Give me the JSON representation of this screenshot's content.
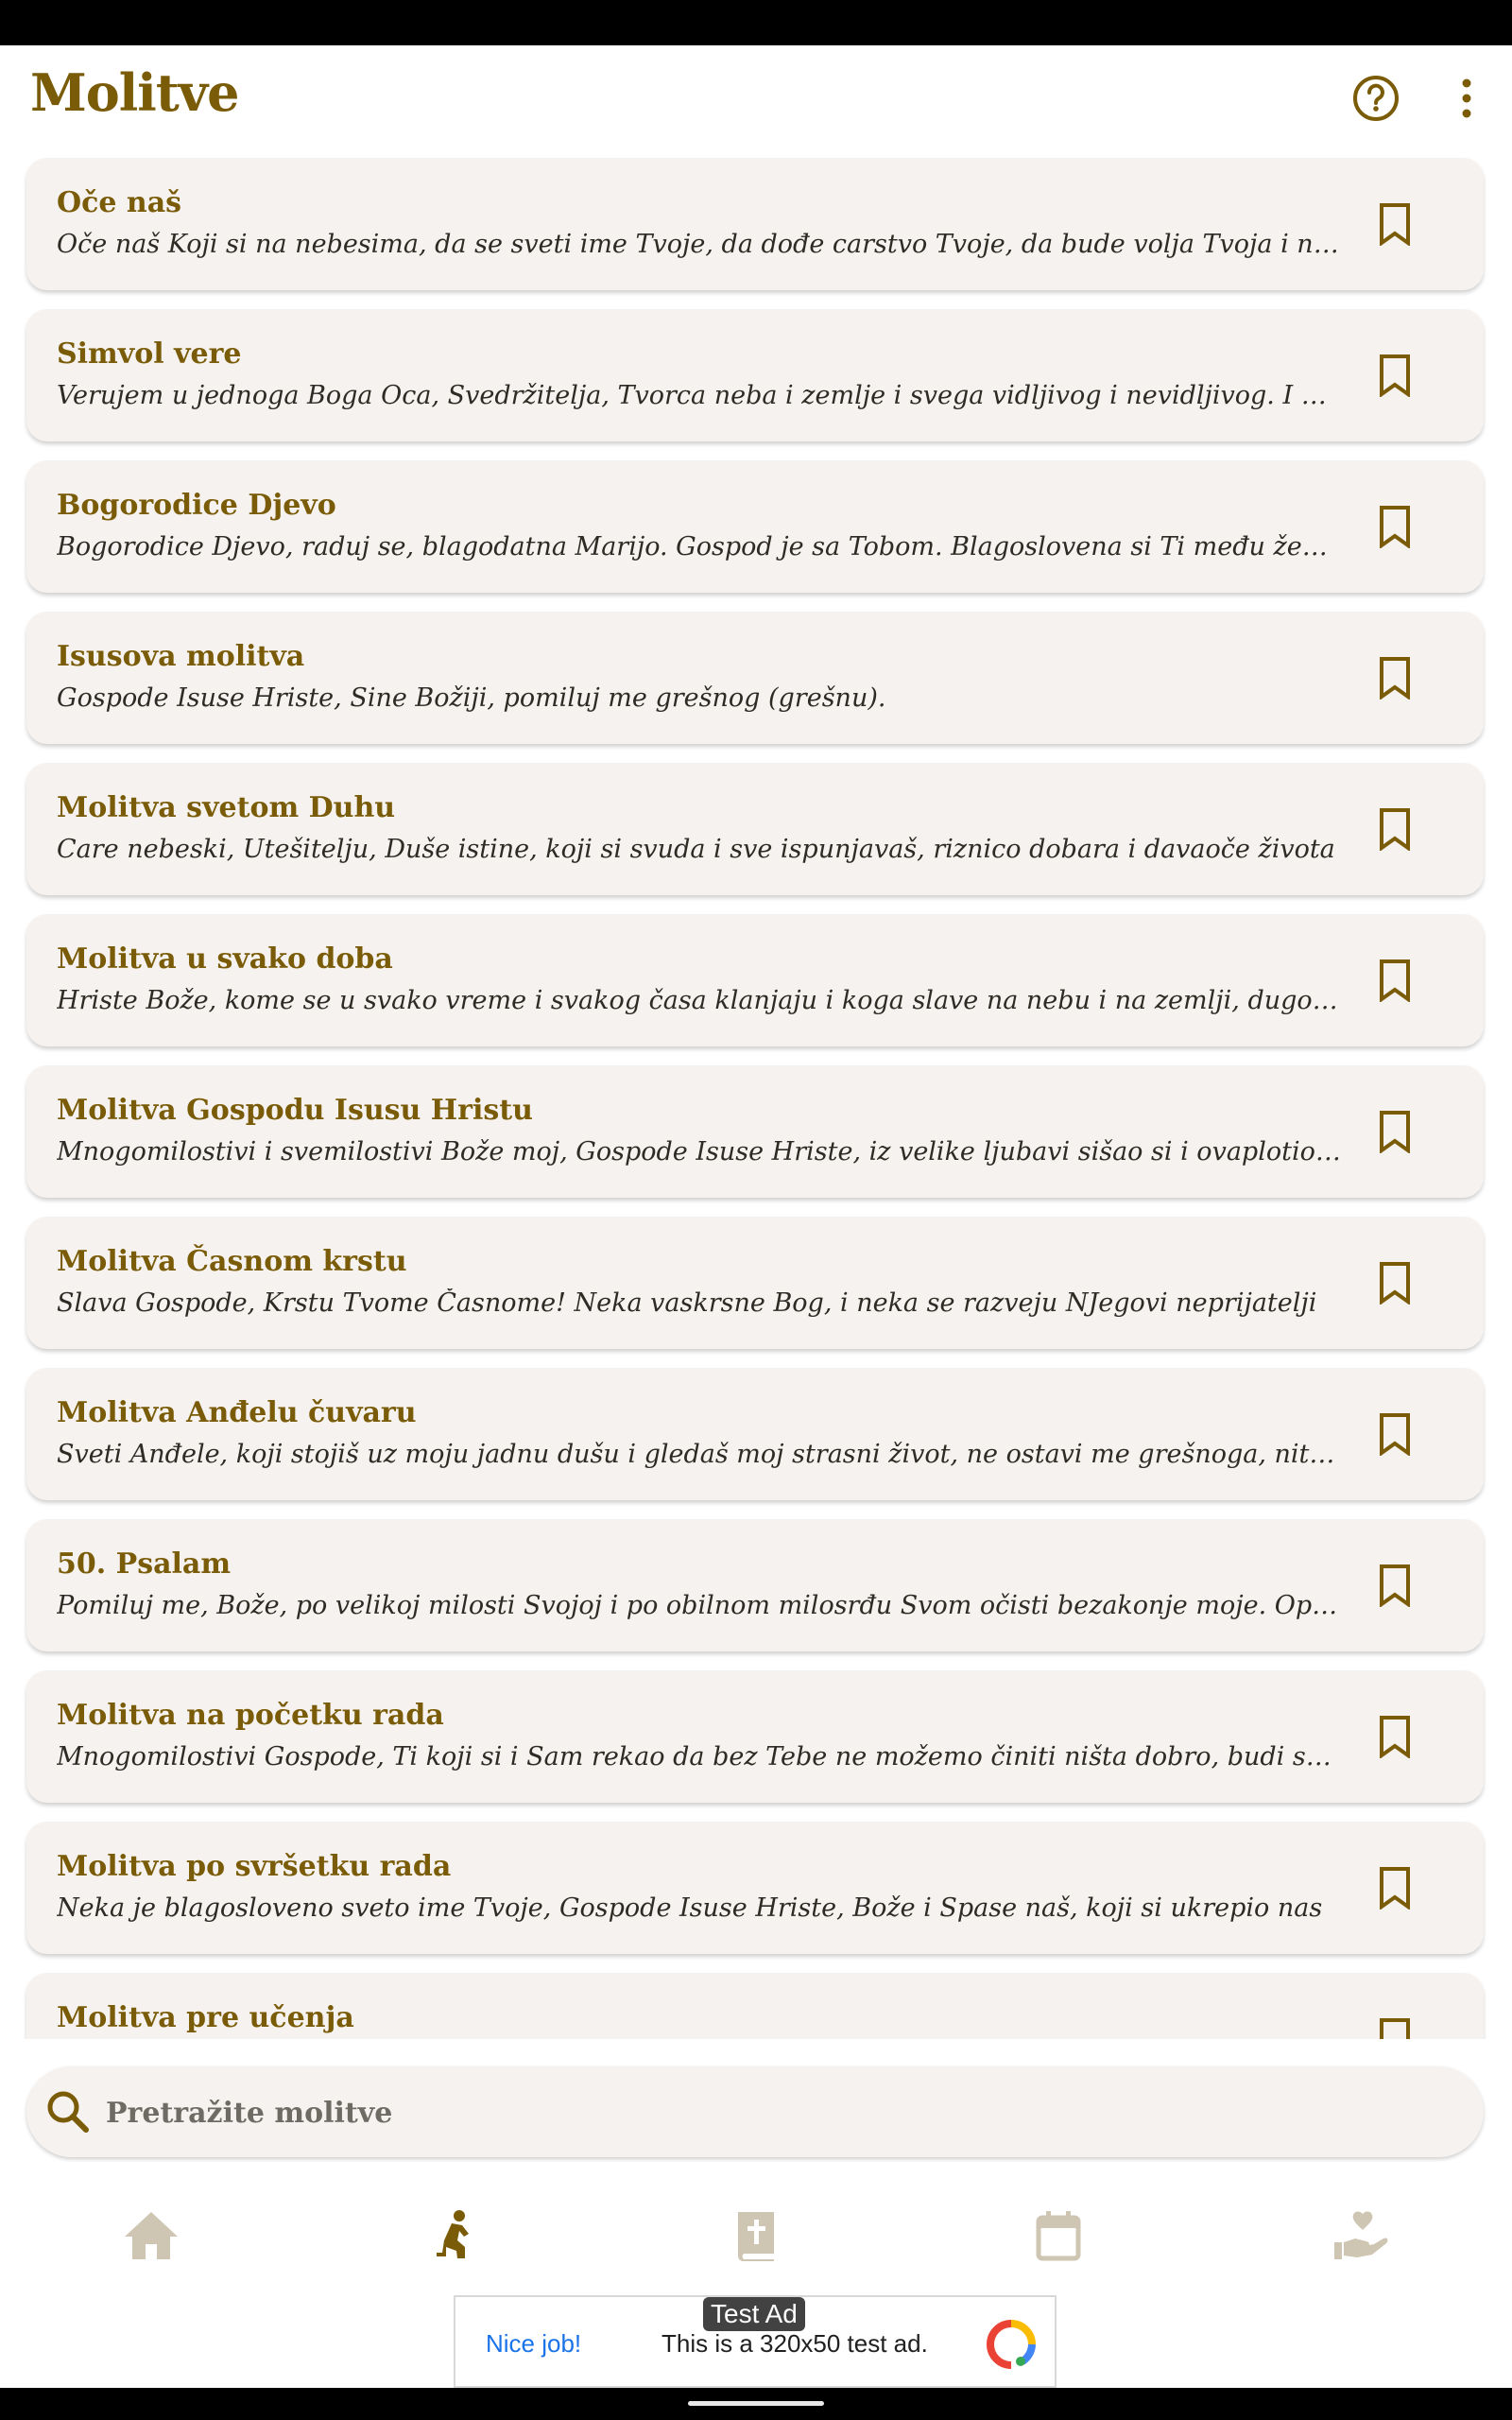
{
  "header": {
    "title": "Molitve",
    "help_icon": "help-circle-icon",
    "more_icon": "more-vertical-icon"
  },
  "prayers": [
    {
      "title": "Oče naš",
      "text": "Oče naš Koji si na nebesima, da se sveti ime Tvoje, da dođe carstvo Tvoje, da bude volja Tvoja i na zemlji kao i na nebu."
    },
    {
      "title": "Simvol vere",
      "text": "Verujem u jednoga Boga Oca, Svedržitelja, Tvorca neba i zemlje i svega vidljivog i nevidljivog. I u jednoga Gospoda Isusa Hrista"
    },
    {
      "title": "Bogorodice Djevo",
      "text": "Bogorodice Djevo, raduj se, blagodatna Marijo. Gospod je sa Tobom. Blagoslovena si Ti među ženama"
    },
    {
      "title": "Isusova molitva",
      "text": "Gospode Isuse Hriste, Sine Božiji, pomiluj me grešnog (grešnu)."
    },
    {
      "title": "Molitva svetom Duhu",
      "text": "Care nebeski, Utešitelju, Duše istine, koji si svuda i sve ispunjavaš, riznico dobara i davaoče života"
    },
    {
      "title": "Molitva u svako doba",
      "text": "Hriste Bože, kome se u svako vreme i svakog časa klanjaju i koga slave na nebu i na zemlji, dugotrpeljivi"
    },
    {
      "title": "Molitva Gospodu Isusu Hristu",
      "text": "Mnogomilostivi i svemilostivi Bože moj, Gospode Isuse Hriste, iz velike ljubavi sišao si i ovaplotio se"
    },
    {
      "title": "Molitva Časnom krstu",
      "text": "Slava Gospode, Krstu Tvome Časnome! Neka vaskrsne Bog, i neka se razveju NJegovi neprijatelji"
    },
    {
      "title": "Molitva Anđelu čuvaru",
      "text": "Sveti Anđele, koji stojiš uz moju jadnu dušu i gledaš moj strasni život, ne ostavi me grešnoga, niti odstupi od mene"
    },
    {
      "title": "50. Psalam",
      "text": "Pomiluj me, Bože, po velikoj milosti Svojoj i po obilnom milosrđu Svom očisti bezakonje moje. Operi me"
    },
    {
      "title": "Molitva na početku rada",
      "text": "Mnogomilostivi Gospode, Ti koji si i Sam rekao da bez Tebe ne možemo činiti ništa dobro, budi sa mnom"
    },
    {
      "title": "Molitva po svršetku rada",
      "text": "Neka je blagosloveno sveto ime Tvoje, Gospode Isuse Hriste, Bože i Spase naš, koji si ukrepio nas"
    },
    {
      "title": "Molitva pre učenja",
      "text": ""
    }
  ],
  "search": {
    "placeholder": "Pretražite molitve",
    "icon": "search-icon"
  },
  "bottom_nav": [
    {
      "name": "home",
      "icon": "home-icon",
      "active": false
    },
    {
      "name": "prayers",
      "icon": "praying-person-icon",
      "active": true
    },
    {
      "name": "bible",
      "icon": "bible-book-icon",
      "active": false
    },
    {
      "name": "calendar",
      "icon": "calendar-icon",
      "active": false
    },
    {
      "name": "charity",
      "icon": "hand-heart-icon",
      "active": false
    }
  ],
  "ad": {
    "label": "Test Ad",
    "nice": "Nice job!",
    "text": "This is a 320x50 test ad."
  },
  "colors": {
    "accent": "#7a5c08",
    "card_bg": "#f6f2ef",
    "inactive_icon": "#cfc5b3"
  }
}
